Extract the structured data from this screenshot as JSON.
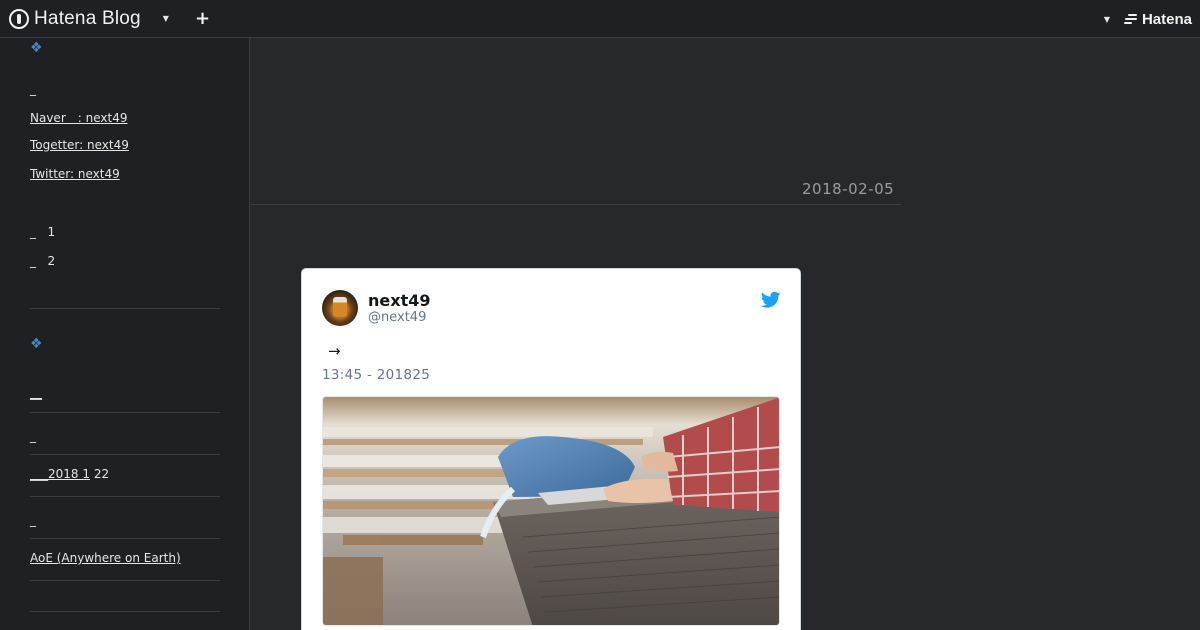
{
  "topbar": {
    "brand": "Hatena Blog",
    "dropdown_icon": "caret-down-icon",
    "add_icon": "plus-icon",
    "user_dropdown_icon": "caret-down-icon",
    "logo_text": "Hatena"
  },
  "sidebar": {
    "section1_icon": "diamond-icon",
    "dash1": "_",
    "links": [
      "Naver　: next49",
      "Togetter: next49",
      "Twitter: next49"
    ],
    "list": [
      {
        "dash": "_",
        "text": "1"
      },
      {
        "dash": "_",
        "text": "2"
      }
    ],
    "section2_icon": "diamond-icon",
    "entries": [
      "__",
      "_",
      "___2018 1",
      "_",
      "AoE (Anywhere on Earth)"
    ],
    "entry3_suffix": " 22"
  },
  "main": {
    "date": "2018-02-05"
  },
  "tweet": {
    "name": "next49",
    "handle": "@next49",
    "body": "→",
    "time": "13:45 - 201825",
    "bird_icon": "twitter-bird-icon",
    "accent": "#1da1f2"
  },
  "colors": {
    "background": "#26282c",
    "topbar": "#1f2023",
    "sidebar": "#1f2023",
    "diamond": "#4a86c8",
    "date": "#9a9ca0"
  }
}
